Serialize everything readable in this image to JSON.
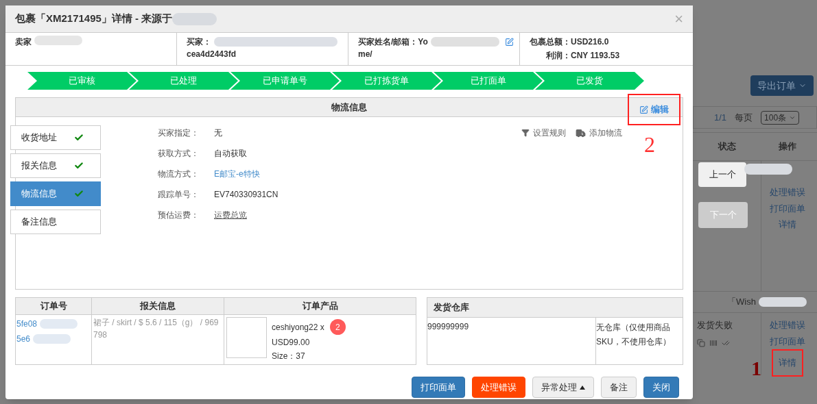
{
  "dialog": {
    "title": "包裹「XM2171495」详情 - 来源于",
    "close": "×",
    "summary": {
      "seller_label": "卖家",
      "buyer_label": "买家：",
      "buyer_id": "cea4d2443fd",
      "name_email_label": "买家姓名/邮箱：",
      "name_email_value": "Yo",
      "name_email_tail": "me/",
      "total_label": "包裹总额：",
      "total": "USD216.0",
      "profit_label": "利润：",
      "profit": "CNY 1193.53"
    },
    "steps": [
      {
        "label": "已审核"
      },
      {
        "label": "已处理"
      },
      {
        "label": "已申请单号"
      },
      {
        "label": "已打拣货单"
      },
      {
        "label": "已打面单"
      },
      {
        "label": "已发货"
      }
    ],
    "logistics": {
      "title": "物流信息",
      "edit": "编辑",
      "tabs": [
        {
          "label": "收货地址",
          "selected": false,
          "checked": true
        },
        {
          "label": "报关信息",
          "selected": false,
          "checked": true
        },
        {
          "label": "物流信息",
          "selected": true,
          "checked": true
        },
        {
          "label": "备注信息",
          "selected": false,
          "checked": false
        }
      ],
      "fields": [
        {
          "label": "买家指定：",
          "value": "无",
          "kind": "text"
        },
        {
          "label": "获取方式：",
          "value": "自动获取",
          "kind": "text"
        },
        {
          "label": "物流方式：",
          "value": "E邮宝-e特快",
          "kind": "link"
        },
        {
          "label": "跟踪单号：",
          "value": "EV740330931CN",
          "kind": "text"
        },
        {
          "label": "预估运费：",
          "value": "运费总览",
          "kind": "underline"
        }
      ],
      "actions": [
        {
          "label": "设置规则",
          "kind": "filter"
        },
        {
          "label": "添加物流",
          "kind": "truck"
        }
      ]
    },
    "order_table": {
      "columns": [
        "订单号",
        "报关信息",
        "订单产品"
      ],
      "order_ids": [
        "5fe08",
        "5e6"
      ],
      "customs": "裙子 / skirt / $ 5.6 / 115（g） / 969798",
      "product": {
        "name": "ceshiyong22 x",
        "quantity": "2",
        "price": "USD99.00",
        "size": "Size：37"
      }
    },
    "warehouse": {
      "title": "发货仓库",
      "code": "999999999",
      "note": "无仓库（仅使用商品SKU，不使用仓库）"
    },
    "buttons": [
      {
        "label": "打印面单",
        "kind": "primary"
      },
      {
        "label": "处理错误",
        "kind": "danger"
      },
      {
        "label": "异常处理",
        "kind": "dropdown"
      },
      {
        "label": "备注",
        "kind": "default"
      },
      {
        "label": "关闭",
        "kind": "primary"
      }
    ]
  },
  "background": {
    "export_button": "导出订单",
    "pager": "1/1",
    "per_page_label": "每页",
    "per_page": "100条",
    "columns": [
      "状态",
      "操作"
    ],
    "prev_button": "上一个",
    "next_button": "下一个",
    "rows": [
      {
        "actions": [
          "处理错误",
          "打印面单",
          "详情"
        ]
      },
      {
        "source": "「Wish",
        "status": "发货失败",
        "actions": [
          "处理错误",
          "打印面单",
          "详情"
        ]
      }
    ]
  },
  "annotations": {
    "edit_marker": "2",
    "detail_marker": "1"
  }
}
